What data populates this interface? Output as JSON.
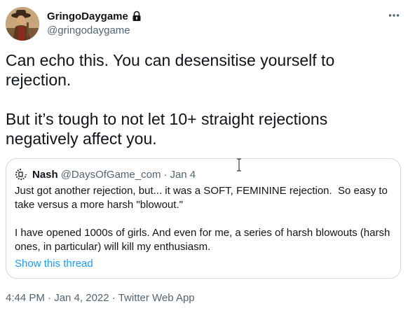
{
  "author": {
    "display_name": "GringoDaygame",
    "handle": "@gringodaygame",
    "protected_icon": "lock-icon",
    "avatar_icon": "cowboy-avatar"
  },
  "tweet": {
    "text": "Can echo this. You can desensitise yourself to\nrejection.\n\nBut it’s tough to not let 10+ straight rejections\nnegatively affect you.",
    "time": "4:44 PM",
    "date": "Jan 4, 2022",
    "source": "Twitter Web App",
    "separator": "·"
  },
  "more_icon": "more-horizontal-icon",
  "quote": {
    "name": "Nash",
    "handle": "@DaysOfGame_com",
    "separator": "·",
    "date": "Jan 4",
    "text": "Just got another rejection, but... it was a SOFT, FEMININE rejection.  So easy to\ntake versus a more harsh \"blowout.\"\n\nI have opened 1000s of girls. And even for me, a series of harsh blowouts (harsh\nones, in particular) will kill my enthusiasm.",
    "show_thread": "Show this thread",
    "avatar_icon": "nash-logo-icon"
  },
  "colors": {
    "text": "#0f1419",
    "secondary": "#536471",
    "link": "#1d9bf0",
    "border": "#cfd9de"
  }
}
